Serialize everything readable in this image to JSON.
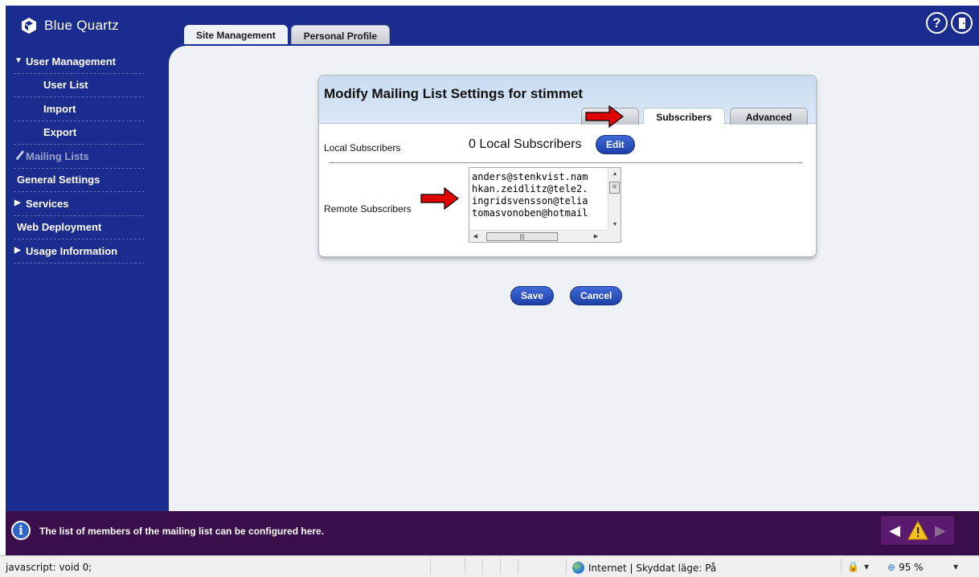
{
  "app": {
    "logo_text": "Blue Quartz"
  },
  "top_tabs": [
    {
      "label": "Site Management"
    },
    {
      "label": "Personal Profile"
    }
  ],
  "header_icons": {
    "help": "help-icon",
    "logout": "logout-icon"
  },
  "sidebar": {
    "items": [
      {
        "label": "User Management"
      },
      {
        "label": "User List"
      },
      {
        "label": "Import"
      },
      {
        "label": "Export"
      },
      {
        "label": "Mailing Lists"
      },
      {
        "label": "General Settings"
      },
      {
        "label": "Services"
      },
      {
        "label": "Web Deployment"
      },
      {
        "label": "Usage Information"
      }
    ]
  },
  "panel": {
    "title": "Modify Mailing List Settings for stimmet",
    "tabs": [
      {
        "label": ""
      },
      {
        "label": "Subscribers"
      },
      {
        "label": "Advanced"
      }
    ],
    "local_label": "Local Subscribers",
    "local_count": "0 Local Subscribers",
    "edit_label": "Edit",
    "remote_label": "Remote Subscribers",
    "remote_value": "anders@stenkvist.nam\nhkan.zeidlitz@tele2.\ningridsvensson@telia\ntomasvonoben@hotmail"
  },
  "actions": {
    "save": "Save",
    "cancel": "Cancel"
  },
  "message": {
    "text": "The list of members of the mailing list can be configured here."
  },
  "statusbar": {
    "left": "javascript: void 0;",
    "zone": "Internet | Skyddat läge: På",
    "zoom": "95 %"
  },
  "colors": {
    "nav_bg": "#1a2c8e",
    "content_bg": "#eef1f6",
    "message_bg": "#3a0e4a",
    "button_blue": "#1f3fa8",
    "arrow_red": "#e00000"
  }
}
